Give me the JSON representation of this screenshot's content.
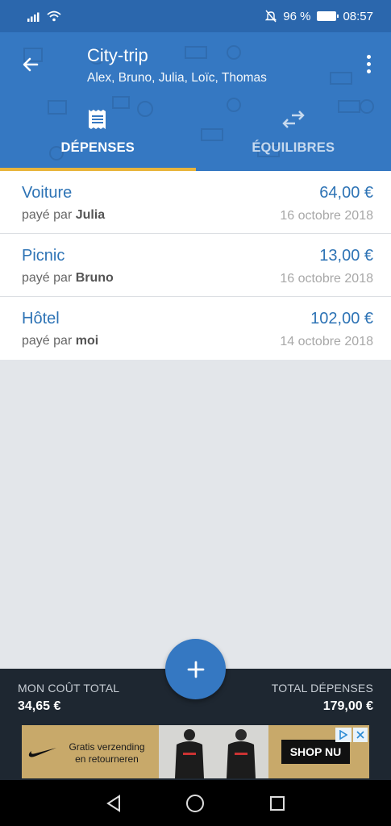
{
  "status_bar": {
    "battery_percent": "96 %",
    "battery_level": 0.96,
    "time": "08:57"
  },
  "header": {
    "title": "City-trip",
    "subtitle": "Alex, Bruno, Julia, Loïc, Thomas"
  },
  "tabs": [
    {
      "label": "DÉPENSES",
      "icon": "receipt-icon",
      "active": true
    },
    {
      "label": "ÉQUILIBRES",
      "icon": "transfer-arrows-icon",
      "active": false
    }
  ],
  "expenses": [
    {
      "title": "Voiture",
      "amount": "64,00 €",
      "payer_prefix": "payé par",
      "payer": "Julia",
      "date": "16 octobre 2018"
    },
    {
      "title": "Picnic",
      "amount": "13,00 €",
      "payer_prefix": "payé par",
      "payer": "Bruno",
      "date": "16 octobre 2018"
    },
    {
      "title": "Hôtel",
      "amount": "102,00 €",
      "payer_prefix": "payé par",
      "payer": "moi",
      "date": "14 octobre 2018"
    }
  ],
  "summary": {
    "my_cost_label": "MON COÛT TOTAL",
    "my_cost_value": "34,65 €",
    "total_label": "TOTAL DÉPENSES",
    "total_value": "179,00 €"
  },
  "ad": {
    "text_line1": "Gratis verzending",
    "text_line2": "en retourneren",
    "cta": "SHOP NU"
  },
  "colors": {
    "primary": "#3578c2",
    "status_bar": "#2b67ad",
    "accent": "#e8b53c",
    "link_text": "#2d73b5",
    "summary_bg": "#1e2731"
  }
}
